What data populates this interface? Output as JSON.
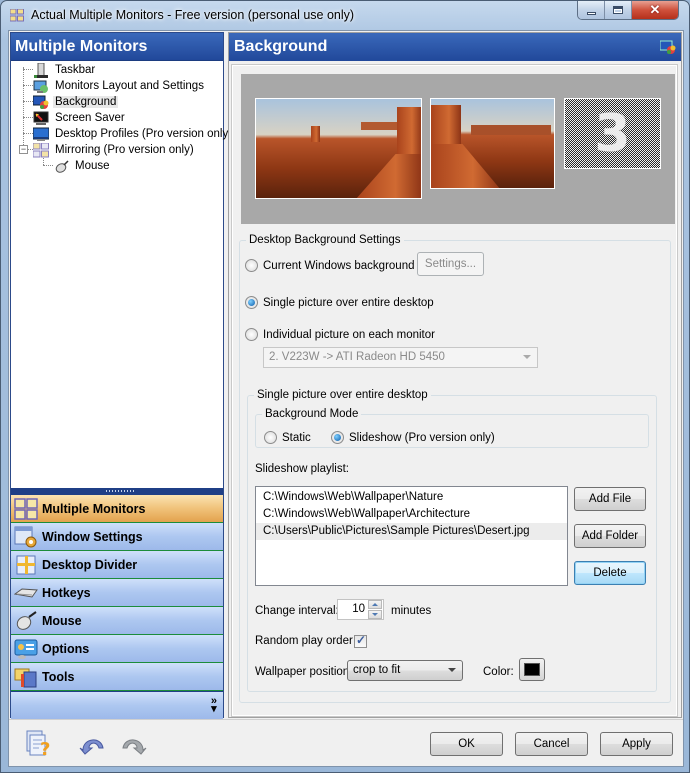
{
  "window": {
    "title": "Actual Multiple Monitors - Free version (personal use only)",
    "controls": {
      "minimize": "minimize",
      "maximize": "maximize",
      "close": "✕"
    }
  },
  "sidebar": {
    "header": "Multiple Monitors",
    "tree": [
      {
        "label": "Taskbar",
        "icon": "taskbar-icon",
        "selected": false
      },
      {
        "label": "Monitors Layout and Settings",
        "icon": "monitors-layout-icon",
        "selected": false
      },
      {
        "label": "Background",
        "icon": "background-icon",
        "selected": true
      },
      {
        "label": "Screen Saver",
        "icon": "screen-saver-icon",
        "selected": false
      },
      {
        "label": "Desktop Profiles (Pro version only)",
        "icon": "desktop-profiles-icon",
        "selected": false
      },
      {
        "label": "Mirroring (Pro version only)",
        "icon": "mirroring-icon",
        "selected": false,
        "expanded": true
      },
      {
        "label": "Mouse",
        "icon": "mouse-icon",
        "selected": false,
        "child": true
      }
    ],
    "nav": [
      {
        "label": "Multiple Monitors",
        "icon": "multiple-monitors-icon",
        "active": true
      },
      {
        "label": "Window Settings",
        "icon": "window-settings-icon",
        "active": false
      },
      {
        "label": "Desktop Divider",
        "icon": "desktop-divider-icon",
        "active": false
      },
      {
        "label": "Hotkeys",
        "icon": "hotkeys-icon",
        "active": false
      },
      {
        "label": "Mouse",
        "icon": "mouse-icon",
        "active": false
      },
      {
        "label": "Options",
        "icon": "options-icon",
        "active": false
      },
      {
        "label": "Tools",
        "icon": "tools-icon",
        "active": false
      }
    ],
    "more_label": "»"
  },
  "panel": {
    "title": "Background",
    "preview": {
      "monitor3_label": "3"
    },
    "desktop_settings": {
      "legend": "Desktop Background Settings",
      "options": [
        {
          "label": "Current Windows background",
          "checked": false
        },
        {
          "label": "Single picture over entire desktop",
          "checked": true
        },
        {
          "label": "Individual picture on each monitor",
          "checked": false
        }
      ],
      "settings_button": "Settings...",
      "monitor_select": "2. V223W -> ATI Radeon HD 5450"
    },
    "single_picture": {
      "legend": "Single picture over entire desktop",
      "mode": {
        "legend": "Background Mode",
        "options": [
          {
            "label": "Static",
            "checked": false
          },
          {
            "label": "Slideshow (Pro version only)",
            "checked": true
          }
        ]
      },
      "playlist_label": "Slideshow playlist:",
      "playlist": [
        "C:\\Windows\\Web\\Wallpaper\\Nature",
        "C:\\Windows\\Web\\Wallpaper\\Architecture",
        "C:\\Users\\Public\\Pictures\\Sample Pictures\\Desert.jpg"
      ],
      "selected_index": 2,
      "buttons": {
        "add_file": "Add File",
        "add_folder": "Add Folder",
        "delete": "Delete"
      },
      "interval_label": "Change interval:",
      "interval_value": "10",
      "interval_unit": "minutes",
      "random_label": "Random play order",
      "random_checked": true,
      "position_label": "Wallpaper position:",
      "position_value": "crop to fit",
      "color_label": "Color:",
      "color_value": "#000000"
    }
  },
  "footer": {
    "ok": "OK",
    "cancel": "Cancel",
    "apply": "Apply"
  },
  "colors": {
    "header_blue": "#21489a",
    "nav_active": "#f0c27a",
    "nav_inactive": "#adc7f0"
  }
}
